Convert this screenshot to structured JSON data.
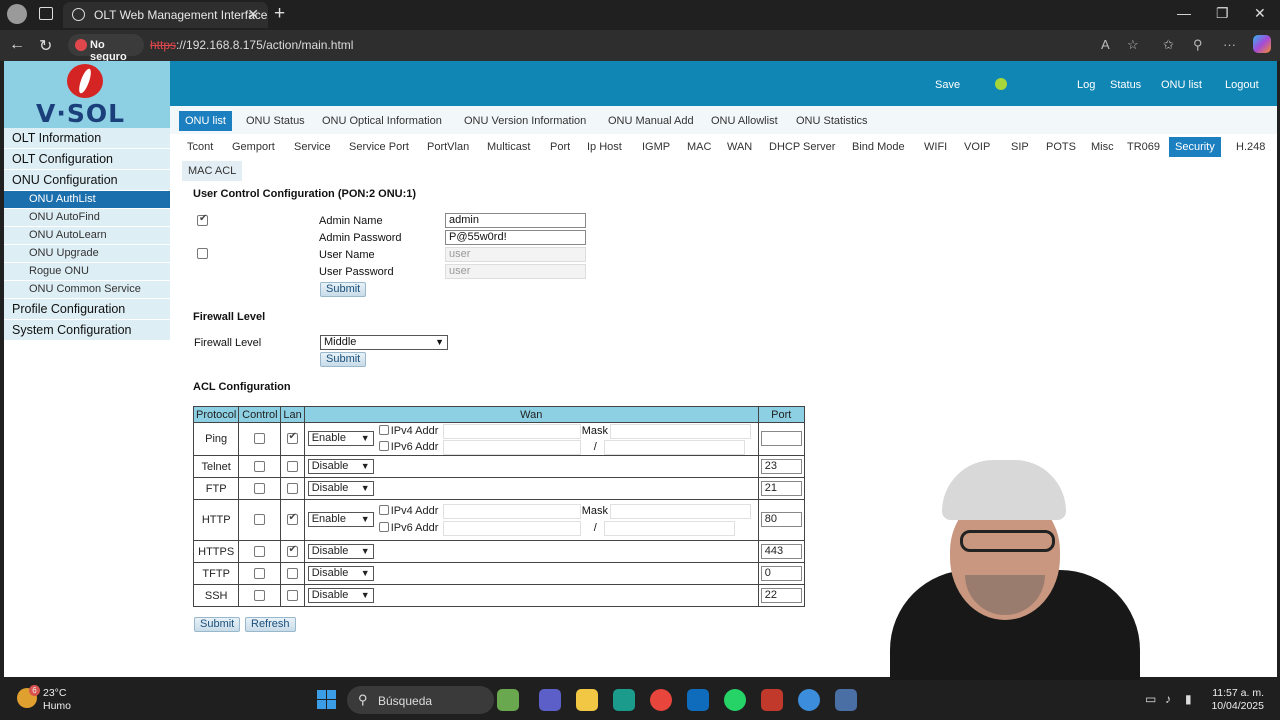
{
  "browser": {
    "tab_title": "OLT Web Management Interface",
    "security_label": "No seguro",
    "url_scheme": "https",
    "url_rest": "://192.168.8.175/action/main.html"
  },
  "header": {
    "logo": "V·SOL",
    "links": [
      "Save",
      "Log",
      "Status",
      "ONU list",
      "Logout"
    ]
  },
  "tabs_top": [
    "ONU list",
    "ONU Status",
    "ONU Optical Information",
    "ONU Version Information",
    "ONU Manual Add",
    "ONU Allowlist",
    "ONU Statistics"
  ],
  "tabs_second": [
    "Tcont",
    "Gemport",
    "Service",
    "Service Port",
    "PortVlan",
    "Multicast",
    "Port",
    "Ip Host",
    "IGMP",
    "MAC",
    "WAN",
    "DHCP Server",
    "Bind Mode",
    "WIFI",
    "VOIP",
    "SIP",
    "POTS",
    "Misc",
    "TR069",
    "Security",
    "H.248"
  ],
  "subtab": "MAC ACL",
  "sidebar": {
    "items": [
      {
        "label": "OLT Information",
        "level": "main"
      },
      {
        "label": "OLT Configuration",
        "level": "main"
      },
      {
        "label": "ONU Configuration",
        "level": "main"
      },
      {
        "label": "ONU AuthList",
        "level": "sub",
        "active": true
      },
      {
        "label": "ONU AutoFind",
        "level": "sub"
      },
      {
        "label": "ONU AutoLearn",
        "level": "sub"
      },
      {
        "label": "ONU Upgrade",
        "level": "sub"
      },
      {
        "label": "Rogue ONU",
        "level": "sub"
      },
      {
        "label": "ONU Common Service",
        "level": "sub"
      },
      {
        "label": "Profile Configuration",
        "level": "main"
      },
      {
        "label": "System Configuration",
        "level": "main"
      }
    ]
  },
  "user_control": {
    "title": "User Control Configuration (PON:2 ONU:1)",
    "admin_name_label": "Admin Name",
    "admin_name_value": "admin",
    "admin_password_label": "Admin Password",
    "admin_password_value": "P@55w0rd!",
    "user_name_label": "User Name",
    "user_name_placeholder": "user",
    "user_password_label": "User Password",
    "user_password_placeholder": "user",
    "submit": "Submit"
  },
  "firewall": {
    "title": "Firewall Level",
    "label": "Firewall Level",
    "value": "Middle",
    "submit": "Submit"
  },
  "acl": {
    "title": "ACL Configuration",
    "headers": [
      "Protocol",
      "Control",
      "Lan",
      "Wan",
      "Port"
    ],
    "ipv4_label": "IPv4 Addr",
    "mask_label": "Mask",
    "ipv6_label": "IPv6 Addr",
    "slash": "/",
    "rows": [
      {
        "protocol": "Ping",
        "control": false,
        "lan": true,
        "wan": "Enable",
        "port": ""
      },
      {
        "protocol": "Telnet",
        "control": false,
        "lan": false,
        "wan": "Disable",
        "port": "23"
      },
      {
        "protocol": "FTP",
        "control": false,
        "lan": false,
        "wan": "Disable",
        "port": "21"
      },
      {
        "protocol": "HTTP",
        "control": false,
        "lan": true,
        "wan": "Enable",
        "port": "80"
      },
      {
        "protocol": "HTTPS",
        "control": false,
        "lan": true,
        "wan": "Disable",
        "port": "443"
      },
      {
        "protocol": "TFTP",
        "control": false,
        "lan": false,
        "wan": "Disable",
        "port": "0"
      },
      {
        "protocol": "SSH",
        "control": false,
        "lan": false,
        "wan": "Disable",
        "port": "22"
      }
    ],
    "submit": "Submit",
    "refresh": "Refresh"
  },
  "taskbar": {
    "temp": "23°C",
    "weather": "Humo",
    "weather_badge": "6",
    "search": "Búsqueda",
    "time": "11:57 a. m.",
    "date": "10/04/2025"
  }
}
